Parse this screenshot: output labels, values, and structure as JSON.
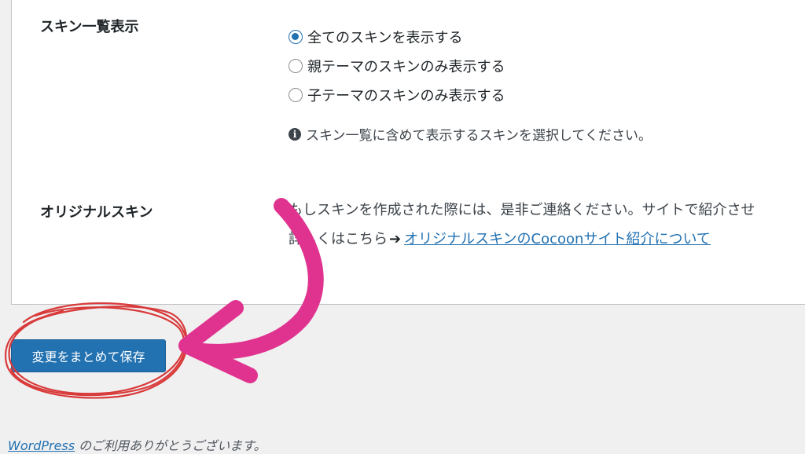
{
  "settings": {
    "skin_list": {
      "label": "スキン一覧表示",
      "options": [
        {
          "label": "全てのスキンを表示する",
          "checked": true
        },
        {
          "label": "親テーマのスキンのみ表示する",
          "checked": false
        },
        {
          "label": "子テーマのスキンのみ表示する",
          "checked": false
        }
      ],
      "help_text": "スキン一覧に含めて表示するスキンを選択してください。"
    },
    "original_skin": {
      "label": "オリジナルスキン",
      "description": "もしスキンを作成された際には、是非ご連絡ください。サイトで紹介させ",
      "details_prefix": "詳しくはこちら",
      "link_text": "オリジナルスキンのCocoonサイト紹介について"
    }
  },
  "save_button": {
    "label": "変更をまとめて保存"
  },
  "footer": {
    "link_text": "WordPress",
    "suffix": " のご利用ありがとうございます。"
  },
  "colors": {
    "primary_button": "#2271b1",
    "annotation_arrow": "#e0338f",
    "annotation_circle": "#d93a3a"
  },
  "icons": {
    "info": "info-icon",
    "arrow": "arrow-right-icon"
  }
}
